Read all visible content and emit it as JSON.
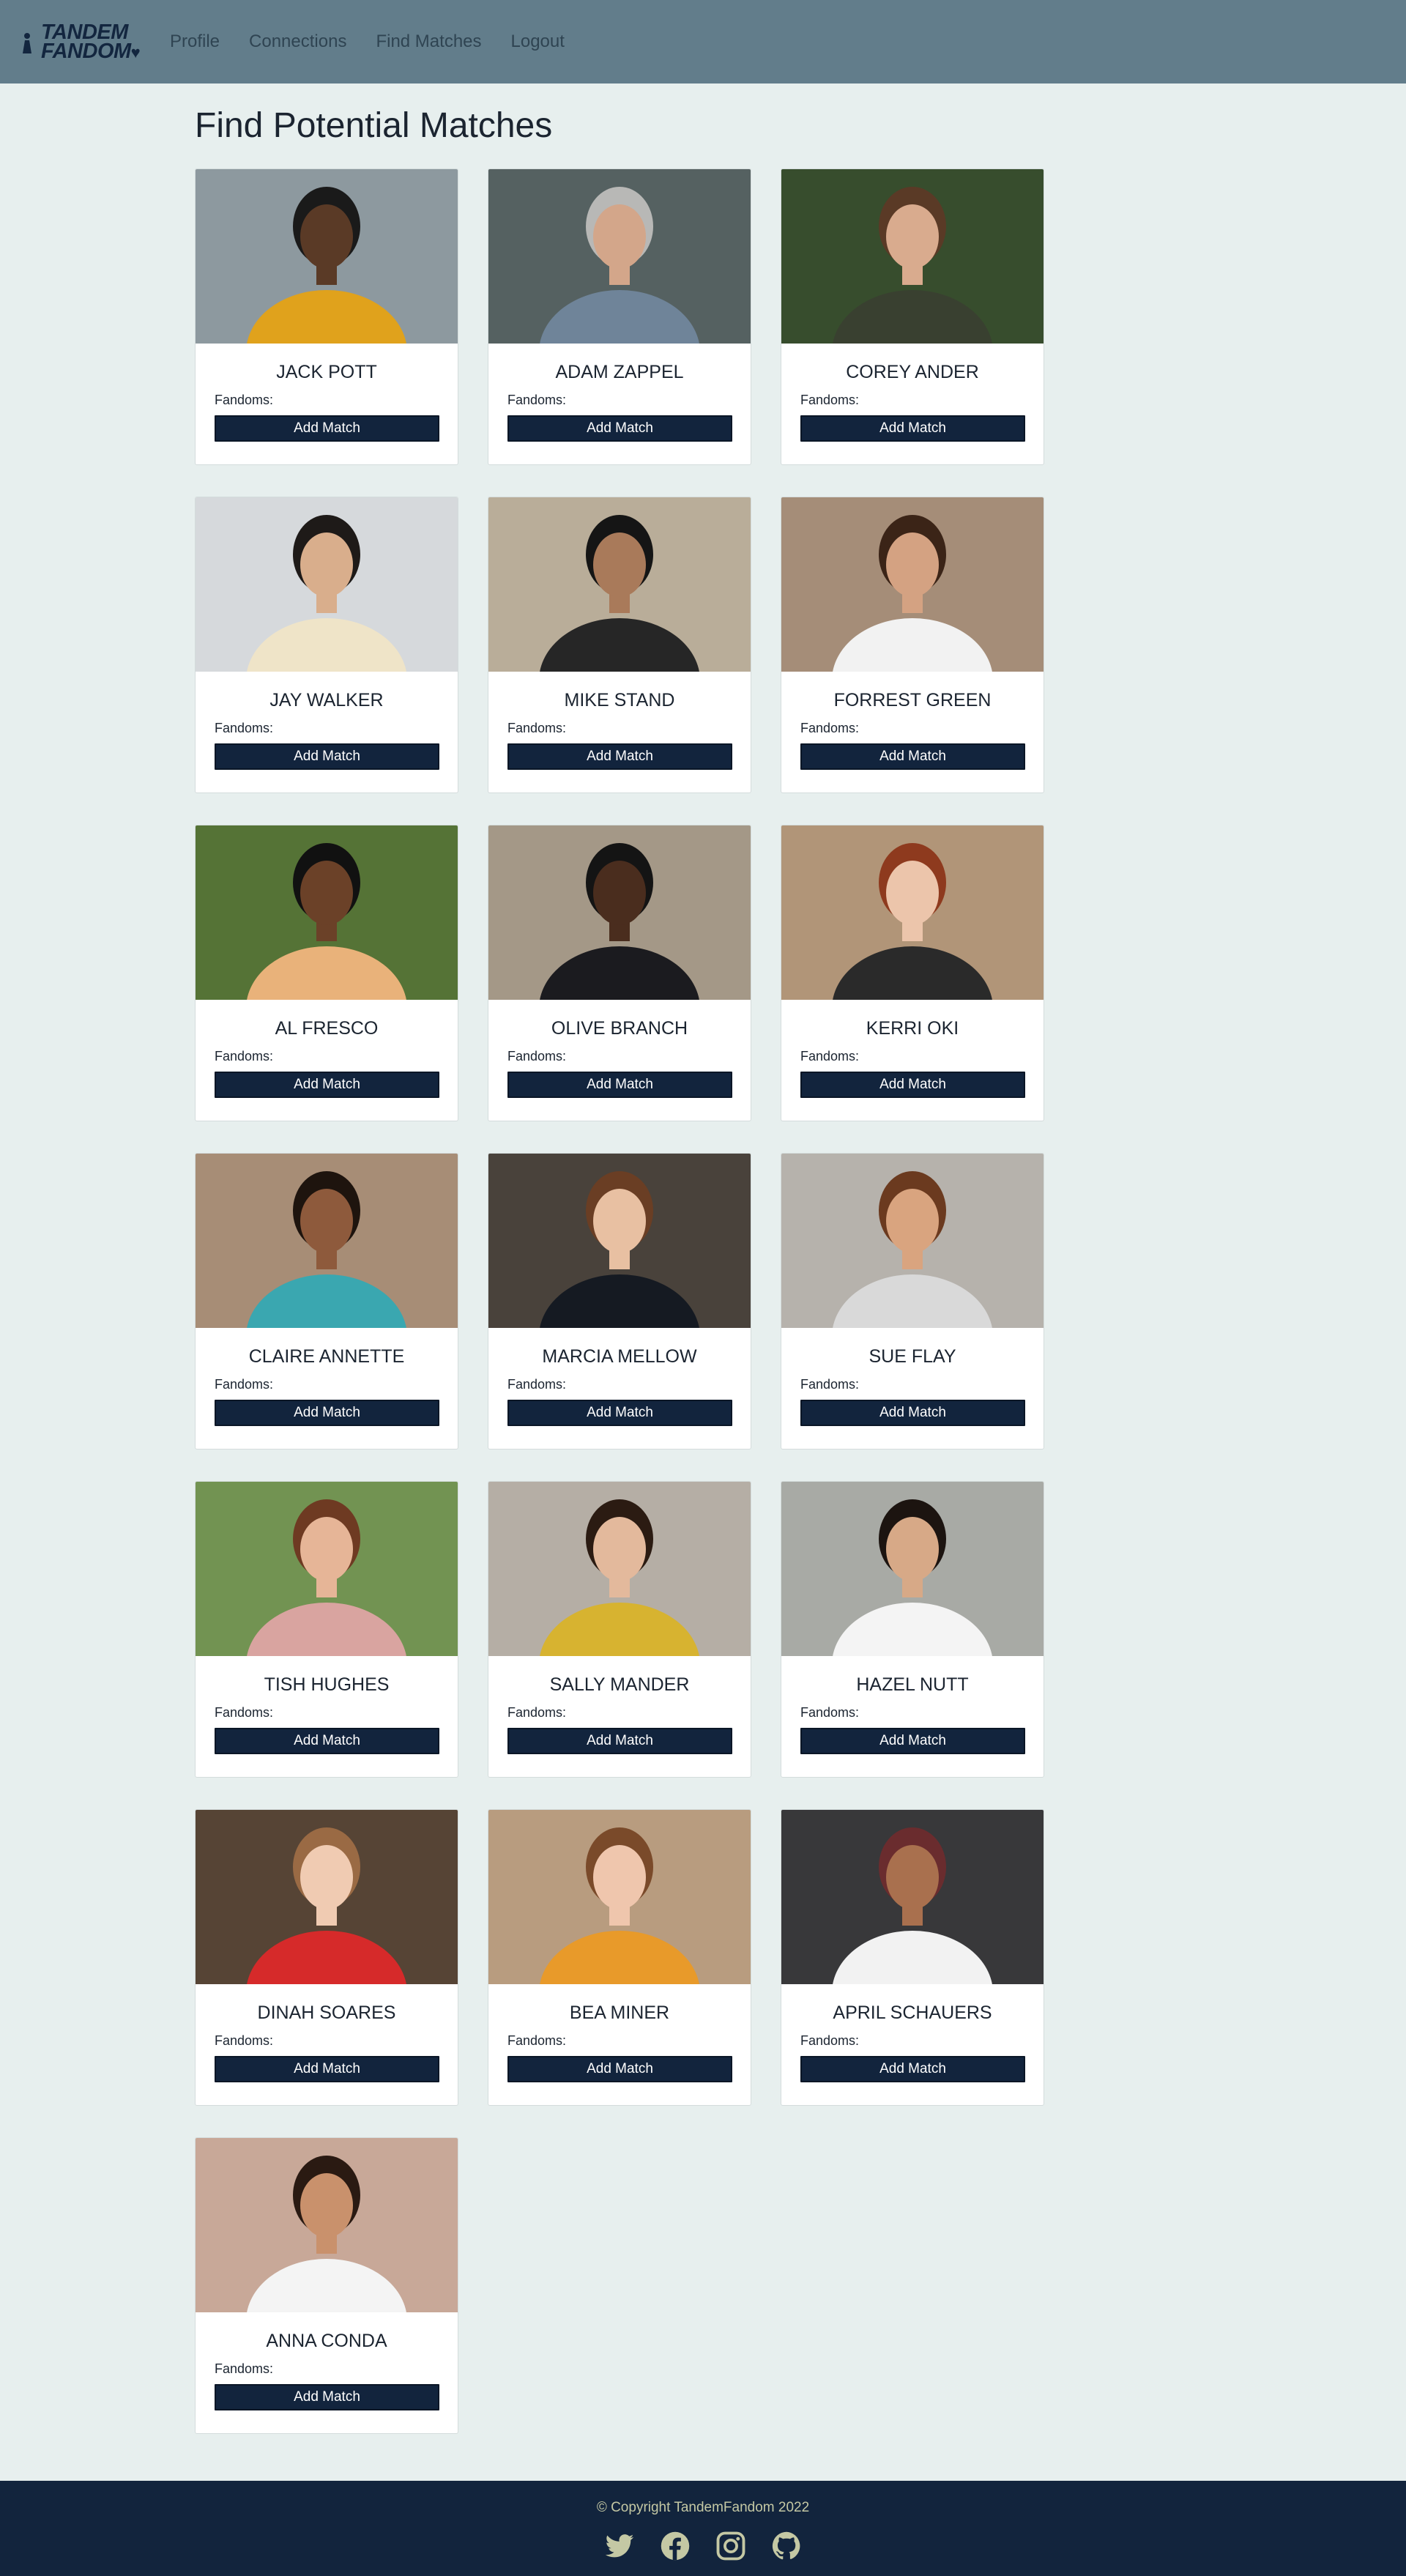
{
  "nav": {
    "brand_line1": "TANDEM",
    "brand_line2": "FANDOM",
    "links": [
      "Profile",
      "Connections",
      "Find Matches",
      "Logout"
    ]
  },
  "page_title": "Find Potential Matches",
  "fandoms_label": "Fandoms:",
  "add_button_label": "Add Match",
  "matches": [
    {
      "name": "JACK POTT",
      "photo": "man-yellow-jacket",
      "bg": "#9aa6ad",
      "skin": "#5a3a26",
      "hair": "#1a1a1a",
      "top": "#e0a21c"
    },
    {
      "name": "ADAM ZAPPEL",
      "photo": "older-man-glasses",
      "bg": "#5d6a6a",
      "skin": "#d3a68a",
      "hair": "#b8b8b6",
      "top": "#6f8499"
    },
    {
      "name": "COREY ANDER",
      "photo": "man-floral-shirt",
      "bg": "#3c5431",
      "skin": "#d9ab8e",
      "hair": "#5a3a26",
      "top": "#394030"
    },
    {
      "name": "JAY WALKER",
      "photo": "man-cream-shirt",
      "bg": "#e9ecef",
      "skin": "#d9ae8c",
      "hair": "#1e1a18",
      "top": "#efe4c8"
    },
    {
      "name": "MIKE STAND",
      "photo": "man-leather-jacket",
      "bg": "#c9bca6",
      "skin": "#a97a5a",
      "hair": "#151515",
      "top": "#262626"
    },
    {
      "name": "FORREST GREEN",
      "photo": "man-laptop-white-tee",
      "bg": "#b39a83",
      "skin": "#d4a282",
      "hair": "#3b2417",
      "top": "#f2f2f2"
    },
    {
      "name": "AL FRESCO",
      "photo": "man-striped-shirt",
      "bg": "#5d7d3b",
      "skin": "#6b4128",
      "hair": "#111111",
      "top": "#e9b27a"
    },
    {
      "name": "OLIVE BRANCH",
      "photo": "woman-black-blazer",
      "bg": "#b2a593",
      "skin": "#4a2d1e",
      "hair": "#141414",
      "top": "#1b1b1f"
    },
    {
      "name": "KERRI OKI",
      "photo": "woman-red-hair-beret",
      "bg": "#c0a283",
      "skin": "#ecc5ab",
      "hair": "#8e3a1e",
      "top": "#2a2a2a"
    },
    {
      "name": "CLAIRE ANNETTE",
      "photo": "woman-curly-hair",
      "bg": "#b69a80",
      "skin": "#8e5a3c",
      "hair": "#1e140e",
      "top": "#3aa7b0"
    },
    {
      "name": "MARCIA MELLOW",
      "photo": "woman-cafe-blazer",
      "bg": "#504840",
      "skin": "#e8c0a2",
      "hair": "#6a3e24",
      "top": "#151a22"
    },
    {
      "name": "SUE FLAY",
      "photo": "woman-striped-top",
      "bg": "#c6c2bb",
      "skin": "#d9a47f",
      "hair": "#6b3a1f",
      "top": "#d9d9d9"
    },
    {
      "name": "TISH HUGHES",
      "photo": "woman-straw-hat",
      "bg": "#7ca05a",
      "skin": "#e6b597",
      "hair": "#6e3a22",
      "top": "#d9a4a0"
    },
    {
      "name": "SALLY MANDER",
      "photo": "woman-yellow-jacket",
      "bg": "#c5bdb3",
      "skin": "#e3b99c",
      "hair": "#2b1b12",
      "top": "#d7b330"
    },
    {
      "name": "HAZEL NUTT",
      "photo": "woman-white-tee-street",
      "bg": "#b7b9b3",
      "skin": "#d7a987",
      "hair": "#1c1410",
      "top": "#f4f4f4"
    },
    {
      "name": "DINAH SOARES",
      "photo": "woman-ice-cream",
      "bg": "#5e4a3a",
      "skin": "#f0cbb2",
      "hair": "#9a6a44",
      "top": "#d62a2a"
    },
    {
      "name": "BEA MINER",
      "photo": "woman-thumbs-up",
      "bg": "#c8aa8a",
      "skin": "#efc6ad",
      "hair": "#7a4a2a",
      "top": "#e89a2a"
    },
    {
      "name": "APRIL SCHAUERS",
      "photo": "woman-hijab",
      "bg": "#3d3d3f",
      "skin": "#a9704e",
      "hair": "#6a2c2e",
      "top": "#f2f2f2"
    },
    {
      "name": "ANNA CONDA",
      "photo": "woman-laptop-card",
      "bg": "#d9b7a5",
      "skin": "#c9916c",
      "hair": "#2a1a12",
      "top": "#f4f4f4"
    }
  ],
  "footer": {
    "copyright": "© Copyright TandemFandom 2022",
    "icon_color": "#c4c8a4",
    "social": [
      "twitter-icon",
      "facebook-icon",
      "instagram-icon",
      "github-icon"
    ]
  }
}
